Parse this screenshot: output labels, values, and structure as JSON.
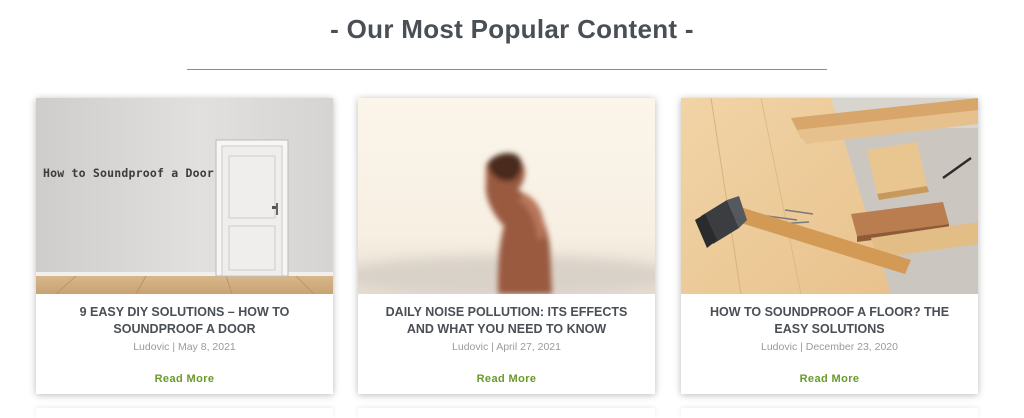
{
  "section": {
    "title": "- Our Most Popular Content -"
  },
  "cards": [
    {
      "image_caption": "How to Soundproof a Door",
      "title": "9 EASY DIY SOLUTIONS – HOW TO SOUNDPROOF A DOOR",
      "author": "Ludovic",
      "date": "May 8, 2021",
      "meta": "Ludovic | May 8, 2021",
      "read_more": "Read More"
    },
    {
      "title": "DAILY NOISE POLLUTION: ITS EFFECTS AND WHAT YOU NEED TO KNOW",
      "author": "Ludovic",
      "date": "April 27, 2021",
      "meta": "Ludovic | April 27, 2021",
      "read_more": "Read More"
    },
    {
      "title": "HOW TO SOUNDPROOF A FLOOR? THE EASY SOLUTIONS",
      "author": "Ludovic",
      "date": "December 23, 2020",
      "meta": "Ludovic | December 23, 2020",
      "read_more": "Read More"
    }
  ],
  "colors": {
    "heading": "#4a4f55",
    "meta": "#9a9a9a",
    "accent": "#6a9a2a",
    "divider": "#8a8a8a"
  }
}
